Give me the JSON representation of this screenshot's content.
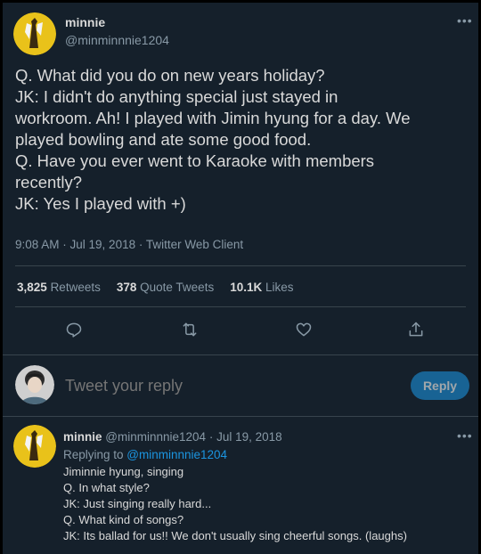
{
  "main_tweet": {
    "display_name": "minnie",
    "handle": "@minminnnie1204",
    "more_icon": "ellipsis-icon",
    "body_lines": [
      "Q. What did you do on new years holiday?",
      "JK: I didn't do anything special just stayed in",
      "workroom. Ah! I played with Jimin hyung for a day. We",
      "played bowling and ate some good food.",
      "Q. Have you ever went to Karaoke with members",
      "recently?",
      "JK: Yes I played with +)"
    ],
    "meta": {
      "time": "9:08 AM",
      "date": "Jul 19, 2018",
      "client": "Twitter Web Client",
      "separator": " · "
    },
    "stats": {
      "retweets_count": "3,825",
      "retweets_label": "Retweets",
      "quotes_count": "378",
      "quotes_label": "Quote Tweets",
      "likes_count": "10.1K",
      "likes_label": "Likes"
    },
    "actions": [
      "reply-icon",
      "retweet-icon",
      "like-icon",
      "share-icon"
    ]
  },
  "composer": {
    "placeholder": "Tweet your reply",
    "button_label": "Reply"
  },
  "reply_tweet": {
    "display_name": "minnie",
    "handle": "@minminnnie1204",
    "separator": " · ",
    "date": "Jul 19, 2018",
    "replying_prefix": "Replying to ",
    "replying_mention": "@minminnnie1204",
    "body_lines": [
      "Jiminnie hyung, singing",
      "Q. In what style?",
      "JK: Just singing really hard...",
      "Q. What kind of songs?",
      "JK: Its ballad for us!! We don't usually sing cheerful songs. (laughs)"
    ]
  },
  "colors": {
    "background": "#15202b",
    "text": "#d9d9d9",
    "secondary": "#8899a6",
    "accent": "#1b95e0",
    "divider": "#38444d"
  }
}
